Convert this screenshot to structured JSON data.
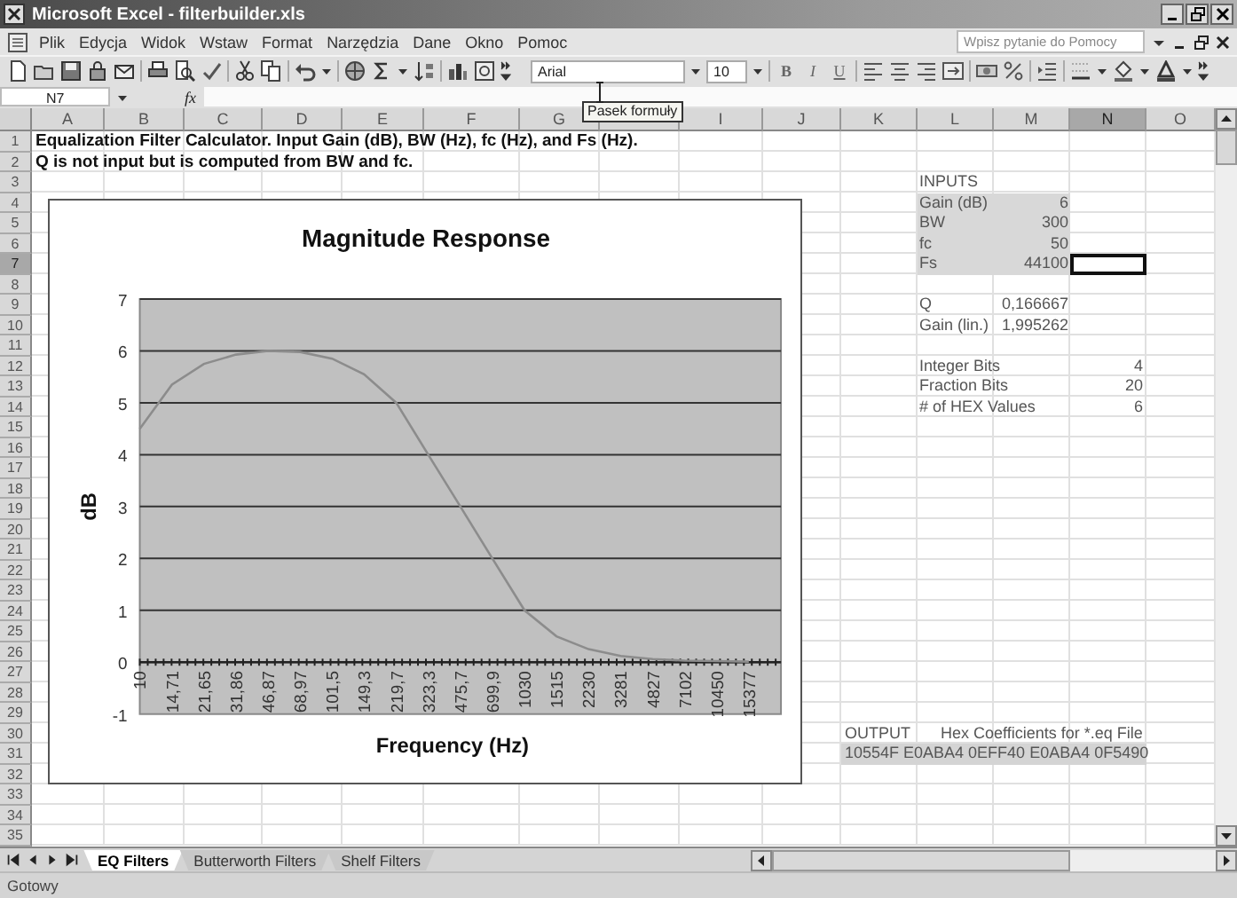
{
  "window": {
    "title": "Microsoft Excel - filterbuilder.xls"
  },
  "menu": [
    "Plik",
    "Edycja",
    "Widok",
    "Wstaw",
    "Format",
    "Narzędzia",
    "Dane",
    "Okno",
    "Pomoc"
  ],
  "help_box": {
    "placeholder": "Wpisz pytanie do Pomocy"
  },
  "toolbar": {
    "font": "Arial",
    "size": "10",
    "format_buttons": [
      "B",
      "I",
      "U"
    ]
  },
  "formula_bar": {
    "name_box": "N7",
    "function_label": "fx"
  },
  "tooltip": "Pasek formuły",
  "columns": [
    {
      "label": "A",
      "selected": false
    },
    {
      "label": "B",
      "selected": false
    },
    {
      "label": "C",
      "selected": false
    },
    {
      "label": "D",
      "selected": false
    },
    {
      "label": "E",
      "selected": false
    },
    {
      "label": "F",
      "selected": false
    },
    {
      "label": "G",
      "selected": false
    },
    {
      "selected": false
    },
    {
      "label": "I",
      "selected": false
    },
    {
      "label": "J",
      "selected": false
    },
    {
      "label": "K",
      "selected": false
    },
    {
      "label": "L",
      "selected": false
    },
    {
      "label": "M",
      "selected": false
    },
    {
      "label": "N",
      "selected": true
    },
    {
      "label": "O",
      "selected": false
    }
  ],
  "rows": [
    {
      "label": "1",
      "selected": false
    },
    {
      "label": "2",
      "selected": false
    },
    {
      "label": "3",
      "selected": false
    },
    {
      "label": "4",
      "selected": false
    },
    {
      "label": "5",
      "selected": false
    },
    {
      "label": "6",
      "selected": false
    },
    {
      "label": "7",
      "selected": true
    },
    {
      "label": "8",
      "selected": false
    },
    {
      "label": "9",
      "selected": false
    },
    {
      "label": "10",
      "selected": false
    },
    {
      "label": "11",
      "selected": false
    },
    {
      "label": "12",
      "selected": false
    },
    {
      "label": "13",
      "selected": false
    },
    {
      "label": "14",
      "selected": false
    },
    {
      "label": "15",
      "selected": false
    },
    {
      "label": "16",
      "selected": false
    },
    {
      "label": "17",
      "selected": false
    },
    {
      "label": "18",
      "selected": false
    },
    {
      "label": "19",
      "selected": false
    },
    {
      "label": "20",
      "selected": false
    },
    {
      "label": "21",
      "selected": false
    },
    {
      "label": "22",
      "selected": false
    },
    {
      "label": "23",
      "selected": false
    },
    {
      "label": "24",
      "selected": false
    },
    {
      "label": "25",
      "selected": false
    },
    {
      "label": "26",
      "selected": false
    },
    {
      "label": "27",
      "selected": false
    },
    {
      "label": "28",
      "selected": false
    },
    {
      "label": "29",
      "selected": false
    },
    {
      "label": "30",
      "selected": false
    },
    {
      "label": "31",
      "selected": false
    },
    {
      "label": "32",
      "selected": false
    },
    {
      "label": "33",
      "selected": false
    },
    {
      "label": "34",
      "selected": false
    },
    {
      "label": "35",
      "selected": false
    }
  ],
  "notes": [
    "Equalization Filter Calculator. Input Gain (dB), BW (Hz), fc (Hz), and Fs (Hz).",
    "Q is not input but is computed from BW and fc."
  ],
  "chart": {
    "chart_data": {
      "type": "line",
      "title": "Magnitude Response",
      "xlabel": "Frequency (Hz)",
      "ylabel": "dB",
      "categories": [
        "10",
        "14,71",
        "21,65",
        "31,86",
        "46,87",
        "68,97",
        "101,5",
        "149,3",
        "219,7",
        "323,3",
        "475,7",
        "699,9",
        "1030",
        "1515",
        "2230",
        "3281",
        "4827",
        "7102",
        "10450",
        "15377"
      ],
      "grid": true,
      "series": [
        {
          "color": "#8c8c8c",
          "values": [
            4.5,
            5.35,
            5.75,
            5.93,
            6.0,
            5.98,
            5.85,
            5.55,
            5.0,
            4.0,
            3.0,
            2.0,
            1.0,
            0.5,
            0.25,
            0.12,
            0.06,
            0.03,
            0.02,
            0.01
          ]
        }
      ],
      "ylim": [
        -1,
        7
      ],
      "yticks": [
        -1,
        0,
        1,
        2,
        3,
        4,
        5,
        6,
        7
      ]
    }
  },
  "inputs": {
    "title": "INPUTS",
    "items": [
      {
        "label": "Gain (dB)",
        "value": "6"
      },
      {
        "label": "BW",
        "value": "300"
      },
      {
        "label": "fc",
        "value": "50"
      },
      {
        "label": "Fs",
        "value": "44100"
      }
    ]
  },
  "computed": [
    {
      "label": "Q",
      "value": "0,166667"
    },
    {
      "label": "Gain (lin.)",
      "value": "1,995262"
    }
  ],
  "bits": [
    {
      "label": "Integer Bits",
      "value": "4"
    },
    {
      "label": "Fraction Bits",
      "value": "20"
    },
    {
      "label": "# of HEX Values",
      "value": "6"
    }
  ],
  "output": {
    "title": "OUTPUT",
    "caption": "Hex Coefficients for *.eq File",
    "value": "10554F E0ABA4 0EFF40 E0ABA4 0F5490"
  },
  "sheet_tabs": [
    {
      "label": "EQ Filters",
      "selected": true
    },
    {
      "label": "Butterworth Filters",
      "selected": false
    },
    {
      "label": "Shelf Filters",
      "selected": false
    }
  ],
  "status_bar": "Gotowy"
}
